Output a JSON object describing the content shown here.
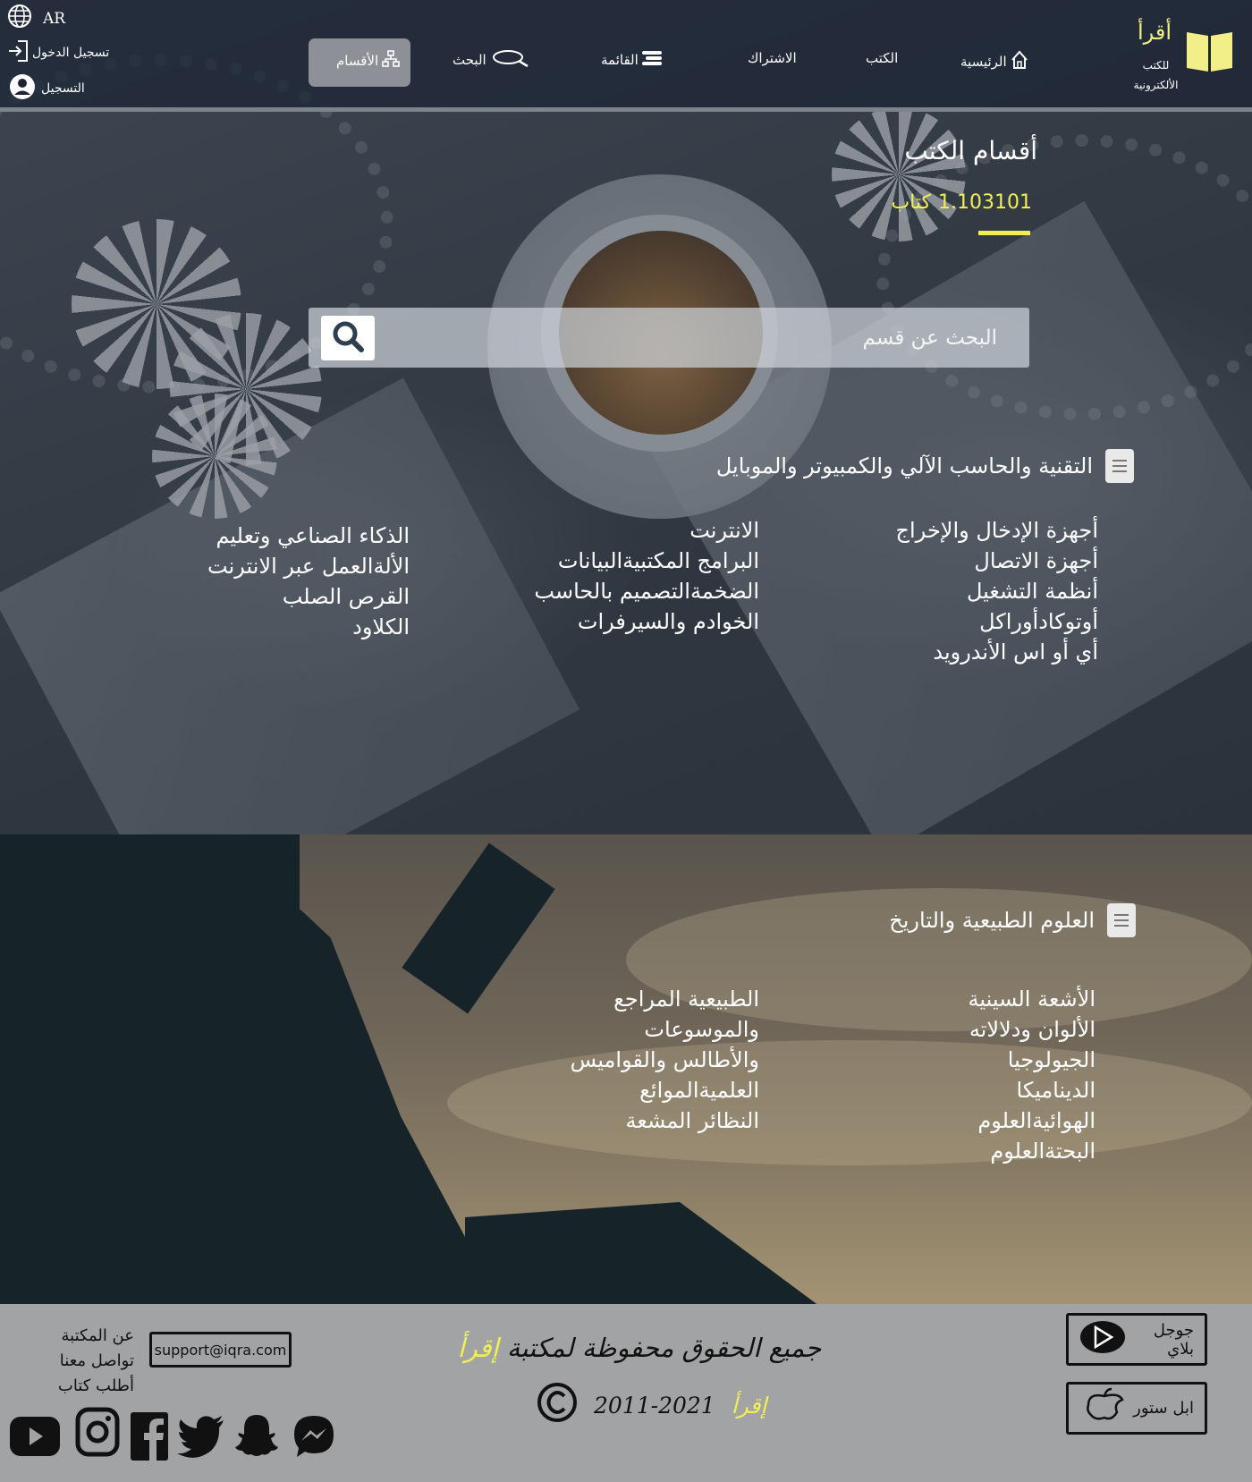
{
  "header": {
    "logo_title": "أقرأ",
    "logo_sub_1": "للكتب",
    "logo_sub_2": "الألكترونية",
    "lang": "AR",
    "login": "تسجيل الدخول",
    "register": "التسجيل",
    "nav": {
      "home": "الرئيسية",
      "books": "الكتب",
      "subscription": "الاشتراك",
      "menu": "القائمة",
      "search": "البحث",
      "sections": "الأقسام"
    }
  },
  "hero": {
    "title": "أقسام الكتب",
    "count_value": "1.103101",
    "count_label": "كتاب"
  },
  "search": {
    "placeholder": "البحث عن قسم"
  },
  "categories": [
    {
      "title": "التقنية والحاسب الآلي والكمبيوتر والموبايل",
      "columns": [
        [
          "أجهزة الإدخال والإخراج",
          "أجهزة الاتصال",
          "أنظمة التشغيل",
          "أوتوكادأوراكل",
          "أي أو اس الأندرويد"
        ],
        [
          "الانترنت",
          "البرامج المكتبيةالبيانات",
          "الضخمةالتصميم بالحاسب",
          "الخوادم والسيرفرات"
        ],
        [
          "الذكاء الصناعي وتعليم",
          "الألةالعمل عبر الانترنت",
          "القرص الصلب",
          "الكلاود"
        ]
      ]
    },
    {
      "title": "العلوم الطبيعية والتاريخ",
      "columns": [
        [
          "الأشعة السينية",
          "الألوان ودلالاته",
          "الجيولوجيا",
          "الديناميكا",
          "الهوائيةالعلوم",
          "البحتةالعلوم"
        ],
        [
          "الطبيعية المراجع",
          "والموسوعات",
          "والأطالس والقواميس",
          "العلميةالموائع",
          "النظائر المشعة"
        ]
      ]
    }
  ],
  "footer": {
    "google_play": "جوجل بلاي",
    "app_store": "ابل ستور",
    "copyright_prefix": "جميع الحقوق محفوظة لمكتبة",
    "brand": "إقرأ",
    "years": "2011-2021",
    "email": "support@iqra.com",
    "links": [
      "عن المكتبة",
      "تواصل معنا",
      "أطلب كتاب"
    ]
  },
  "colors": {
    "accent_yellow": "#f2ef55",
    "footer_bg": "#a2a3a5",
    "header_bg": "#1c2434"
  }
}
